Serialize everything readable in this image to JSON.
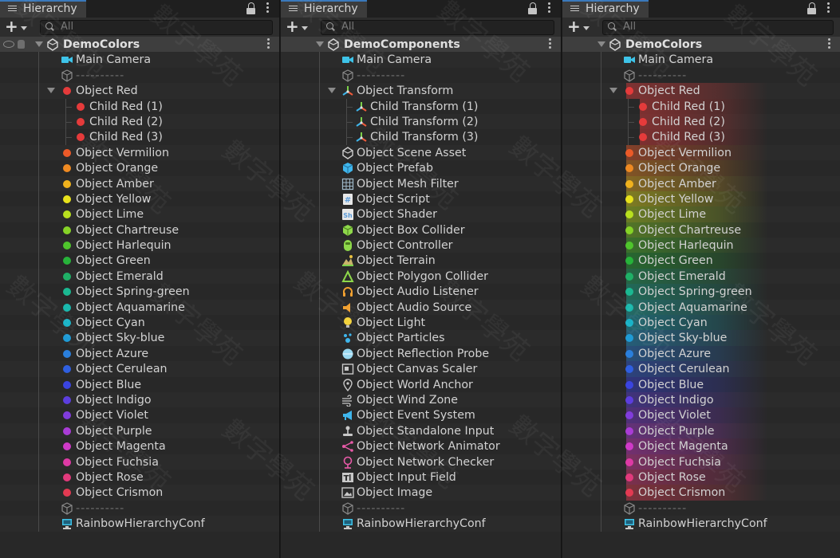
{
  "panels": [
    {
      "tab_title": "Hierarchy",
      "search_placeholder": "All",
      "scene_name": "DemoColors",
      "mode": "color",
      "rows": [
        {
          "label": "Main Camera",
          "icon": "camera-icon",
          "level": 1,
          "color": "#3ec3e8"
        },
        {
          "label": "----------",
          "icon": "cube-outline-icon",
          "level": 1,
          "sep": true
        },
        {
          "label": "Object Red",
          "icon": "dot-icon",
          "level": 1,
          "color": "#e53b3b",
          "expand": true
        },
        {
          "label": "Child Red (1)",
          "icon": "dot-icon",
          "level": 2,
          "color": "#e53b3b"
        },
        {
          "label": "Child Red (2)",
          "icon": "dot-icon",
          "level": 2,
          "color": "#e53b3b"
        },
        {
          "label": "Child Red (3)",
          "icon": "dot-icon",
          "level": 2,
          "color": "#e53b3b"
        },
        {
          "label": "Object Vermilion",
          "icon": "dot-icon",
          "level": 1,
          "color": "#ec5a28"
        },
        {
          "label": "Object Orange",
          "icon": "dot-icon",
          "level": 1,
          "color": "#ef8a22"
        },
        {
          "label": "Object Amber",
          "icon": "dot-icon",
          "level": 1,
          "color": "#f0b21d"
        },
        {
          "label": "Object Yellow",
          "icon": "dot-icon",
          "level": 1,
          "color": "#e8e21c"
        },
        {
          "label": "Object Lime",
          "icon": "dot-icon",
          "level": 1,
          "color": "#b8e01e"
        },
        {
          "label": "Object Chartreuse",
          "icon": "dot-icon",
          "level": 1,
          "color": "#86d327"
        },
        {
          "label": "Object Harlequin",
          "icon": "dot-icon",
          "level": 1,
          "color": "#4fc52c"
        },
        {
          "label": "Object Green",
          "icon": "dot-icon",
          "level": 1,
          "color": "#27b33a"
        },
        {
          "label": "Object Emerald",
          "icon": "dot-icon",
          "level": 1,
          "color": "#1fb066"
        },
        {
          "label": "Object Spring-green",
          "icon": "dot-icon",
          "level": 1,
          "color": "#1bb891"
        },
        {
          "label": "Object Aquamarine",
          "icon": "dot-icon",
          "level": 1,
          "color": "#1ab8ad"
        },
        {
          "label": "Object Cyan",
          "icon": "dot-icon",
          "level": 1,
          "color": "#18b3c7"
        },
        {
          "label": "Object Sky-blue",
          "icon": "dot-icon",
          "level": 1,
          "color": "#1f9bd6"
        },
        {
          "label": "Object Azure",
          "icon": "dot-icon",
          "level": 1,
          "color": "#2a7fdc"
        },
        {
          "label": "Object Cerulean",
          "icon": "dot-icon",
          "level": 1,
          "color": "#2f5fe0"
        },
        {
          "label": "Object Blue",
          "icon": "dot-icon",
          "level": 1,
          "color": "#3a44e0"
        },
        {
          "label": "Object Indigo",
          "icon": "dot-icon",
          "level": 1,
          "color": "#5c3ede"
        },
        {
          "label": "Object Violet",
          "icon": "dot-icon",
          "level": 1,
          "color": "#813cdc"
        },
        {
          "label": "Object Purple",
          "icon": "dot-icon",
          "level": 1,
          "color": "#a93cd6"
        },
        {
          "label": "Object Magenta",
          "icon": "dot-icon",
          "level": 1,
          "color": "#cf3ac8"
        },
        {
          "label": "Object Fuchsia",
          "icon": "dot-icon",
          "level": 1,
          "color": "#de3aa5"
        },
        {
          "label": "Object Rose",
          "icon": "dot-icon",
          "level": 1,
          "color": "#e23a7c"
        },
        {
          "label": "Object Crismon",
          "icon": "dot-icon",
          "level": 1,
          "color": "#e33a52"
        },
        {
          "label": "----------",
          "icon": "cube-outline-icon",
          "level": 1,
          "sep": true
        },
        {
          "label": "RainbowHierarchyConf",
          "icon": "config-monitor-icon",
          "level": 1,
          "color": "#3ec3e8"
        }
      ]
    },
    {
      "tab_title": "Hierarchy",
      "search_placeholder": "All",
      "scene_name": "DemoComponents",
      "mode": "component",
      "rows": [
        {
          "label": "Main Camera",
          "icon": "camera-icon",
          "level": 1,
          "color": "#3ec3e8"
        },
        {
          "label": "----------",
          "icon": "cube-outline-icon",
          "level": 1,
          "sep": true
        },
        {
          "label": "Object Transform",
          "icon": "transform-icon",
          "level": 1,
          "color": "#f0a030",
          "expand": true
        },
        {
          "label": "Child Transform (1)",
          "icon": "transform-icon",
          "level": 2,
          "color": "#f0a030"
        },
        {
          "label": "Child Transform (2)",
          "icon": "transform-icon",
          "level": 2,
          "color": "#f0a030"
        },
        {
          "label": "Child Transform (3)",
          "icon": "transform-icon",
          "level": 2,
          "color": "#f0a030"
        },
        {
          "label": "Object Scene Asset",
          "icon": "unity-scene-icon",
          "level": 1,
          "color": "#d0d0d0"
        },
        {
          "label": "Object Prefab",
          "icon": "prefab-cube-icon",
          "level": 1,
          "color": "#3fb6ec"
        },
        {
          "label": "Object Mesh Filter",
          "icon": "mesh-grid-icon",
          "level": 1,
          "color": "#9fb8c8"
        },
        {
          "label": "Object Script",
          "icon": "script-hash-icon",
          "level": 1,
          "color": "#5b9bd8"
        },
        {
          "label": "Object Shader",
          "icon": "shader-icon",
          "level": 1,
          "color": "#5b9bd8"
        },
        {
          "label": "Object Box Collider",
          "icon": "box-collider-icon",
          "level": 1,
          "color": "#8ed84a"
        },
        {
          "label": "Object Controller",
          "icon": "controller-icon",
          "level": 1,
          "color": "#8ed84a"
        },
        {
          "label": "Object Terrain",
          "icon": "terrain-icon",
          "level": 1,
          "color": "#e8c040"
        },
        {
          "label": "Object Polygon Collider",
          "icon": "polygon-collider-icon",
          "level": 1,
          "color": "#8ed84a"
        },
        {
          "label": "Object Audio Listener",
          "icon": "headphones-icon",
          "level": 1,
          "color": "#f0a030"
        },
        {
          "label": "Object Audio Source",
          "icon": "speaker-icon",
          "level": 1,
          "color": "#f0a030"
        },
        {
          "label": "Object Light",
          "icon": "light-bulb-icon",
          "level": 1,
          "color": "#f3d23a"
        },
        {
          "label": "Object Particles",
          "icon": "particles-icon",
          "level": 1,
          "color": "#3fb6ec"
        },
        {
          "label": "Object Reflection Probe",
          "icon": "reflection-probe-icon",
          "level": 1,
          "color": "#9ad8f0"
        },
        {
          "label": "Object Canvas Scaler",
          "icon": "canvas-scaler-icon",
          "level": 1,
          "color": "#c8c8c8"
        },
        {
          "label": "Object World Anchor",
          "icon": "map-pin-icon",
          "level": 1,
          "color": "#c8c8c8"
        },
        {
          "label": "Object Wind Zone",
          "icon": "wind-icon",
          "level": 1,
          "color": "#c8c8c8"
        },
        {
          "label": "Object Event System",
          "icon": "megaphone-icon",
          "level": 1,
          "color": "#3fb6ec"
        },
        {
          "label": "Object Standalone Input",
          "icon": "joystick-icon",
          "level": 1,
          "color": "#c8c8c8"
        },
        {
          "label": "Object Network Animator",
          "icon": "network-animator-icon",
          "level": 1,
          "color": "#e85aa8"
        },
        {
          "label": "Object Network Checker",
          "icon": "network-checker-icon",
          "level": 1,
          "color": "#e85aa8"
        },
        {
          "label": "Object Input Field",
          "icon": "input-field-icon",
          "level": 1,
          "color": "#c8c8c8"
        },
        {
          "label": "Object Image",
          "icon": "image-icon",
          "level": 1,
          "color": "#c8c8c8"
        },
        {
          "label": "----------",
          "icon": "cube-outline-icon",
          "level": 1,
          "sep": true
        },
        {
          "label": "RainbowHierarchyConf",
          "icon": "config-monitor-icon",
          "level": 1,
          "color": "#3ec3e8"
        }
      ]
    },
    {
      "tab_title": "Hierarchy",
      "search_placeholder": "All",
      "scene_name": "DemoColors",
      "mode": "color-bg",
      "rows": [
        {
          "label": "Main Camera",
          "icon": "camera-icon",
          "level": 1,
          "color": "#3ec3e8"
        },
        {
          "label": "----------",
          "icon": "cube-outline-icon",
          "level": 1,
          "sep": true
        },
        {
          "label": "Object Red",
          "icon": "dot-icon",
          "level": 1,
          "color": "#e53b3b",
          "expand": true
        },
        {
          "label": "Child Red (1)",
          "icon": "dot-icon",
          "level": 2,
          "color": "#e53b3b"
        },
        {
          "label": "Child Red (2)",
          "icon": "dot-icon",
          "level": 2,
          "color": "#e53b3b"
        },
        {
          "label": "Child Red (3)",
          "icon": "dot-icon",
          "level": 2,
          "color": "#e53b3b"
        },
        {
          "label": "Object Vermilion",
          "icon": "dot-icon",
          "level": 1,
          "color": "#ec5a28"
        },
        {
          "label": "Object Orange",
          "icon": "dot-icon",
          "level": 1,
          "color": "#ef8a22"
        },
        {
          "label": "Object Amber",
          "icon": "dot-icon",
          "level": 1,
          "color": "#f0b21d"
        },
        {
          "label": "Object Yellow",
          "icon": "dot-icon",
          "level": 1,
          "color": "#e8e21c"
        },
        {
          "label": "Object Lime",
          "icon": "dot-icon",
          "level": 1,
          "color": "#b8e01e"
        },
        {
          "label": "Object Chartreuse",
          "icon": "dot-icon",
          "level": 1,
          "color": "#86d327"
        },
        {
          "label": "Object Harlequin",
          "icon": "dot-icon",
          "level": 1,
          "color": "#4fc52c"
        },
        {
          "label": "Object Green",
          "icon": "dot-icon",
          "level": 1,
          "color": "#27b33a"
        },
        {
          "label": "Object Emerald",
          "icon": "dot-icon",
          "level": 1,
          "color": "#1fb066"
        },
        {
          "label": "Object Spring-green",
          "icon": "dot-icon",
          "level": 1,
          "color": "#1bb891"
        },
        {
          "label": "Object Aquamarine",
          "icon": "dot-icon",
          "level": 1,
          "color": "#1ab8ad"
        },
        {
          "label": "Object Cyan",
          "icon": "dot-icon",
          "level": 1,
          "color": "#18b3c7"
        },
        {
          "label": "Object Sky-blue",
          "icon": "dot-icon",
          "level": 1,
          "color": "#1f9bd6"
        },
        {
          "label": "Object Azure",
          "icon": "dot-icon",
          "level": 1,
          "color": "#2a7fdc"
        },
        {
          "label": "Object Cerulean",
          "icon": "dot-icon",
          "level": 1,
          "color": "#2f5fe0"
        },
        {
          "label": "Object Blue",
          "icon": "dot-icon",
          "level": 1,
          "color": "#3a44e0"
        },
        {
          "label": "Object Indigo",
          "icon": "dot-icon",
          "level": 1,
          "color": "#5c3ede"
        },
        {
          "label": "Object Violet",
          "icon": "dot-icon",
          "level": 1,
          "color": "#813cdc"
        },
        {
          "label": "Object Purple",
          "icon": "dot-icon",
          "level": 1,
          "color": "#a93cd6"
        },
        {
          "label": "Object Magenta",
          "icon": "dot-icon",
          "level": 1,
          "color": "#cf3ac8"
        },
        {
          "label": "Object Fuchsia",
          "icon": "dot-icon",
          "level": 1,
          "color": "#de3aa5"
        },
        {
          "label": "Object Rose",
          "icon": "dot-icon",
          "level": 1,
          "color": "#e23a7c"
        },
        {
          "label": "Object Crismon",
          "icon": "dot-icon",
          "level": 1,
          "color": "#e33a52"
        },
        {
          "label": "----------",
          "icon": "cube-outline-icon",
          "level": 1,
          "sep": true
        },
        {
          "label": "RainbowHierarchyConf",
          "icon": "config-monitor-icon",
          "level": 1,
          "color": "#3ec3e8"
        }
      ]
    }
  ],
  "watermark_text": "數字學苑"
}
